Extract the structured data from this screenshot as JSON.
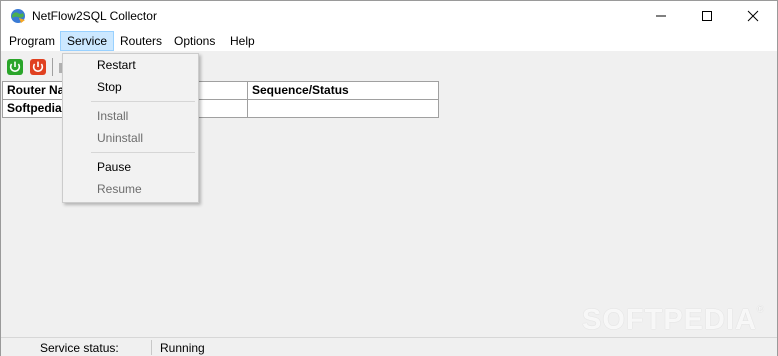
{
  "window": {
    "title": "NetFlow2SQL Collector",
    "icon": "globe-icon"
  },
  "menubar": {
    "items": [
      {
        "label": "Program"
      },
      {
        "label": "Service"
      },
      {
        "label": "Routers"
      },
      {
        "label": "Options"
      },
      {
        "label": "Help"
      }
    ]
  },
  "toolbar": {
    "start_icon": "power-start-icon",
    "stop_icon": "power-stop-icon"
  },
  "table": {
    "columns": [
      "Router Na",
      "",
      "Sequence/Status"
    ],
    "rows": [
      [
        "Softpedia",
        "",
        ""
      ]
    ]
  },
  "service_menu": {
    "items": [
      {
        "label": "Restart",
        "enabled": true
      },
      {
        "label": "Stop",
        "enabled": true
      },
      {
        "label": "Install",
        "enabled": false
      },
      {
        "label": "Uninstall",
        "enabled": false
      },
      {
        "label": "Pause",
        "enabled": true
      },
      {
        "label": "Resume",
        "enabled": false
      }
    ]
  },
  "watermark": {
    "text": "SOFTPEDIA",
    "mark": "®"
  },
  "statusbar": {
    "label": "Service status:",
    "value": "Running"
  },
  "colors": {
    "menu_highlight": "#cce8ff",
    "start_green": "#2aa52a",
    "stop_red": "#e04020"
  }
}
